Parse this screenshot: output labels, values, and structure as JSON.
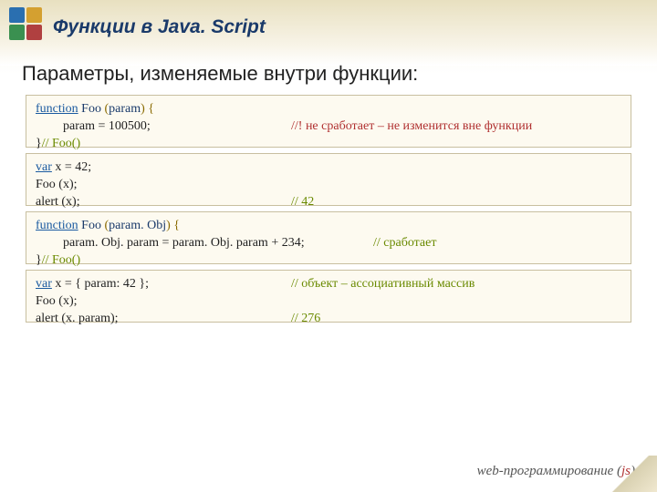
{
  "title": "Функции в Java. Script",
  "subtitle": "Параметры, изменяемые внутри функции:",
  "box1": {
    "l1a": "function",
    "l1b": " Foo ",
    "l1c": "(",
    "l1d": "param",
    "l1e": ") {",
    "l2a": "param = 100500;",
    "l2c": "//! не сработает – не изменится вне функции",
    "l3a": "}",
    "l3b": "// Foo()"
  },
  "box2": {
    "l1a": "var",
    "l1b": " x = 42;",
    "l2": "Foo (x);",
    "l3a": "alert (x);",
    "l3c": "// 42"
  },
  "box3": {
    "l1a": "function",
    "l1b": " Foo ",
    "l1c": "(",
    "l1d": "param. Obj",
    "l1e": ") {",
    "l2a": "param. Obj. param = param. Obj. param + 234;",
    "l2c": "// сработает",
    "l3a": "}",
    "l3b": "// Foo()"
  },
  "box4": {
    "l1a": "var",
    "l1b": " x = { param: 42 };",
    "l1c": "// объект – ассоциативный массив",
    "l2": "Foo (x);",
    "l3a": "alert (x. param);",
    "l3c": "// 276"
  },
  "footer_a": "web-программирование (",
  "footer_b": "js",
  "footer_c": ")"
}
